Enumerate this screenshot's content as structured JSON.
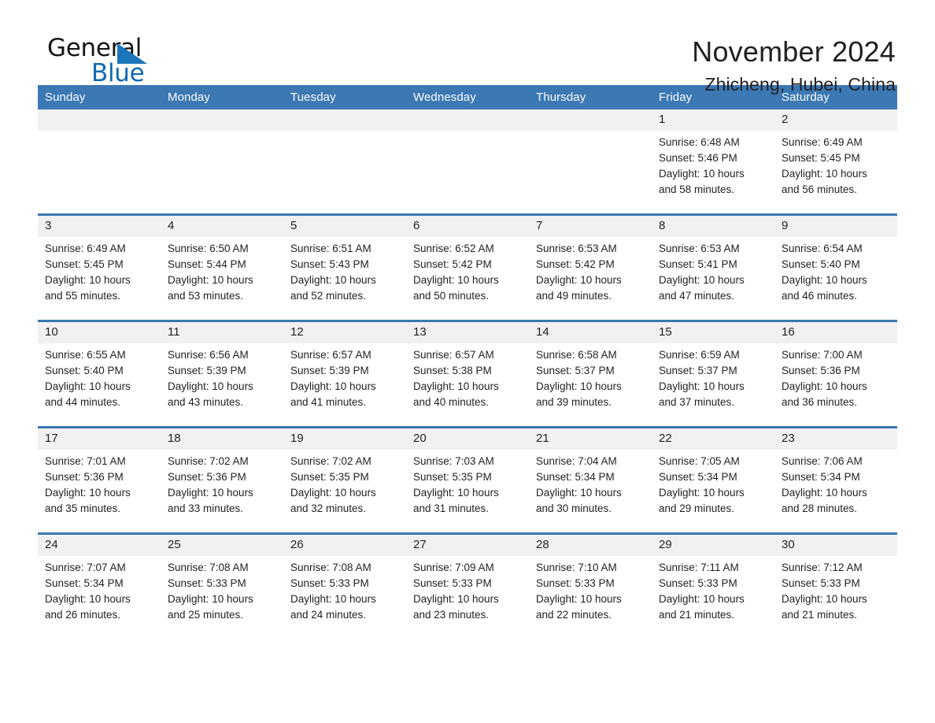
{
  "brand": {
    "name_part1": "General",
    "name_part2": "Blue",
    "flag_icon": "triangle-flag-icon",
    "accent_color": "#1b75bb"
  },
  "header": {
    "month_title": "November 2024",
    "location": "Zhicheng, Hubei, China"
  },
  "theme": {
    "header_row_bg": "#3b78b4",
    "daynum_bg": "#f1f1f1",
    "separator": "#3b78b4",
    "text": "#231f20"
  },
  "weekday_headers": [
    "Sunday",
    "Monday",
    "Tuesday",
    "Wednesday",
    "Thursday",
    "Friday",
    "Saturday"
  ],
  "weeks": [
    [
      {
        "day": "",
        "empty": true,
        "sunrise": "",
        "sunset": "",
        "daylight_line1": "",
        "daylight_line2": ""
      },
      {
        "day": "",
        "empty": true,
        "sunrise": "",
        "sunset": "",
        "daylight_line1": "",
        "daylight_line2": ""
      },
      {
        "day": "",
        "empty": true,
        "sunrise": "",
        "sunset": "",
        "daylight_line1": "",
        "daylight_line2": ""
      },
      {
        "day": "",
        "empty": true,
        "sunrise": "",
        "sunset": "",
        "daylight_line1": "",
        "daylight_line2": ""
      },
      {
        "day": "",
        "empty": true,
        "sunrise": "",
        "sunset": "",
        "daylight_line1": "",
        "daylight_line2": ""
      },
      {
        "day": "1",
        "empty": false,
        "sunrise": "Sunrise: 6:48 AM",
        "sunset": "Sunset: 5:46 PM",
        "daylight_line1": "Daylight: 10 hours",
        "daylight_line2": "and 58 minutes."
      },
      {
        "day": "2",
        "empty": false,
        "sunrise": "Sunrise: 6:49 AM",
        "sunset": "Sunset: 5:45 PM",
        "daylight_line1": "Daylight: 10 hours",
        "daylight_line2": "and 56 minutes."
      }
    ],
    [
      {
        "day": "3",
        "empty": false,
        "sunrise": "Sunrise: 6:49 AM",
        "sunset": "Sunset: 5:45 PM",
        "daylight_line1": "Daylight: 10 hours",
        "daylight_line2": "and 55 minutes."
      },
      {
        "day": "4",
        "empty": false,
        "sunrise": "Sunrise: 6:50 AM",
        "sunset": "Sunset: 5:44 PM",
        "daylight_line1": "Daylight: 10 hours",
        "daylight_line2": "and 53 minutes."
      },
      {
        "day": "5",
        "empty": false,
        "sunrise": "Sunrise: 6:51 AM",
        "sunset": "Sunset: 5:43 PM",
        "daylight_line1": "Daylight: 10 hours",
        "daylight_line2": "and 52 minutes."
      },
      {
        "day": "6",
        "empty": false,
        "sunrise": "Sunrise: 6:52 AM",
        "sunset": "Sunset: 5:42 PM",
        "daylight_line1": "Daylight: 10 hours",
        "daylight_line2": "and 50 minutes."
      },
      {
        "day": "7",
        "empty": false,
        "sunrise": "Sunrise: 6:53 AM",
        "sunset": "Sunset: 5:42 PM",
        "daylight_line1": "Daylight: 10 hours",
        "daylight_line2": "and 49 minutes."
      },
      {
        "day": "8",
        "empty": false,
        "sunrise": "Sunrise: 6:53 AM",
        "sunset": "Sunset: 5:41 PM",
        "daylight_line1": "Daylight: 10 hours",
        "daylight_line2": "and 47 minutes."
      },
      {
        "day": "9",
        "empty": false,
        "sunrise": "Sunrise: 6:54 AM",
        "sunset": "Sunset: 5:40 PM",
        "daylight_line1": "Daylight: 10 hours",
        "daylight_line2": "and 46 minutes."
      }
    ],
    [
      {
        "day": "10",
        "empty": false,
        "sunrise": "Sunrise: 6:55 AM",
        "sunset": "Sunset: 5:40 PM",
        "daylight_line1": "Daylight: 10 hours",
        "daylight_line2": "and 44 minutes."
      },
      {
        "day": "11",
        "empty": false,
        "sunrise": "Sunrise: 6:56 AM",
        "sunset": "Sunset: 5:39 PM",
        "daylight_line1": "Daylight: 10 hours",
        "daylight_line2": "and 43 minutes."
      },
      {
        "day": "12",
        "empty": false,
        "sunrise": "Sunrise: 6:57 AM",
        "sunset": "Sunset: 5:39 PM",
        "daylight_line1": "Daylight: 10 hours",
        "daylight_line2": "and 41 minutes."
      },
      {
        "day": "13",
        "empty": false,
        "sunrise": "Sunrise: 6:57 AM",
        "sunset": "Sunset: 5:38 PM",
        "daylight_line1": "Daylight: 10 hours",
        "daylight_line2": "and 40 minutes."
      },
      {
        "day": "14",
        "empty": false,
        "sunrise": "Sunrise: 6:58 AM",
        "sunset": "Sunset: 5:37 PM",
        "daylight_line1": "Daylight: 10 hours",
        "daylight_line2": "and 39 minutes."
      },
      {
        "day": "15",
        "empty": false,
        "sunrise": "Sunrise: 6:59 AM",
        "sunset": "Sunset: 5:37 PM",
        "daylight_line1": "Daylight: 10 hours",
        "daylight_line2": "and 37 minutes."
      },
      {
        "day": "16",
        "empty": false,
        "sunrise": "Sunrise: 7:00 AM",
        "sunset": "Sunset: 5:36 PM",
        "daylight_line1": "Daylight: 10 hours",
        "daylight_line2": "and 36 minutes."
      }
    ],
    [
      {
        "day": "17",
        "empty": false,
        "sunrise": "Sunrise: 7:01 AM",
        "sunset": "Sunset: 5:36 PM",
        "daylight_line1": "Daylight: 10 hours",
        "daylight_line2": "and 35 minutes."
      },
      {
        "day": "18",
        "empty": false,
        "sunrise": "Sunrise: 7:02 AM",
        "sunset": "Sunset: 5:36 PM",
        "daylight_line1": "Daylight: 10 hours",
        "daylight_line2": "and 33 minutes."
      },
      {
        "day": "19",
        "empty": false,
        "sunrise": "Sunrise: 7:02 AM",
        "sunset": "Sunset: 5:35 PM",
        "daylight_line1": "Daylight: 10 hours",
        "daylight_line2": "and 32 minutes."
      },
      {
        "day": "20",
        "empty": false,
        "sunrise": "Sunrise: 7:03 AM",
        "sunset": "Sunset: 5:35 PM",
        "daylight_line1": "Daylight: 10 hours",
        "daylight_line2": "and 31 minutes."
      },
      {
        "day": "21",
        "empty": false,
        "sunrise": "Sunrise: 7:04 AM",
        "sunset": "Sunset: 5:34 PM",
        "daylight_line1": "Daylight: 10 hours",
        "daylight_line2": "and 30 minutes."
      },
      {
        "day": "22",
        "empty": false,
        "sunrise": "Sunrise: 7:05 AM",
        "sunset": "Sunset: 5:34 PM",
        "daylight_line1": "Daylight: 10 hours",
        "daylight_line2": "and 29 minutes."
      },
      {
        "day": "23",
        "empty": false,
        "sunrise": "Sunrise: 7:06 AM",
        "sunset": "Sunset: 5:34 PM",
        "daylight_line1": "Daylight: 10 hours",
        "daylight_line2": "and 28 minutes."
      }
    ],
    [
      {
        "day": "24",
        "empty": false,
        "sunrise": "Sunrise: 7:07 AM",
        "sunset": "Sunset: 5:34 PM",
        "daylight_line1": "Daylight: 10 hours",
        "daylight_line2": "and 26 minutes."
      },
      {
        "day": "25",
        "empty": false,
        "sunrise": "Sunrise: 7:08 AM",
        "sunset": "Sunset: 5:33 PM",
        "daylight_line1": "Daylight: 10 hours",
        "daylight_line2": "and 25 minutes."
      },
      {
        "day": "26",
        "empty": false,
        "sunrise": "Sunrise: 7:08 AM",
        "sunset": "Sunset: 5:33 PM",
        "daylight_line1": "Daylight: 10 hours",
        "daylight_line2": "and 24 minutes."
      },
      {
        "day": "27",
        "empty": false,
        "sunrise": "Sunrise: 7:09 AM",
        "sunset": "Sunset: 5:33 PM",
        "daylight_line1": "Daylight: 10 hours",
        "daylight_line2": "and 23 minutes."
      },
      {
        "day": "28",
        "empty": false,
        "sunrise": "Sunrise: 7:10 AM",
        "sunset": "Sunset: 5:33 PM",
        "daylight_line1": "Daylight: 10 hours",
        "daylight_line2": "and 22 minutes."
      },
      {
        "day": "29",
        "empty": false,
        "sunrise": "Sunrise: 7:11 AM",
        "sunset": "Sunset: 5:33 PM",
        "daylight_line1": "Daylight: 10 hours",
        "daylight_line2": "and 21 minutes."
      },
      {
        "day": "30",
        "empty": false,
        "sunrise": "Sunrise: 7:12 AM",
        "sunset": "Sunset: 5:33 PM",
        "daylight_line1": "Daylight: 10 hours",
        "daylight_line2": "and 21 minutes."
      }
    ]
  ]
}
